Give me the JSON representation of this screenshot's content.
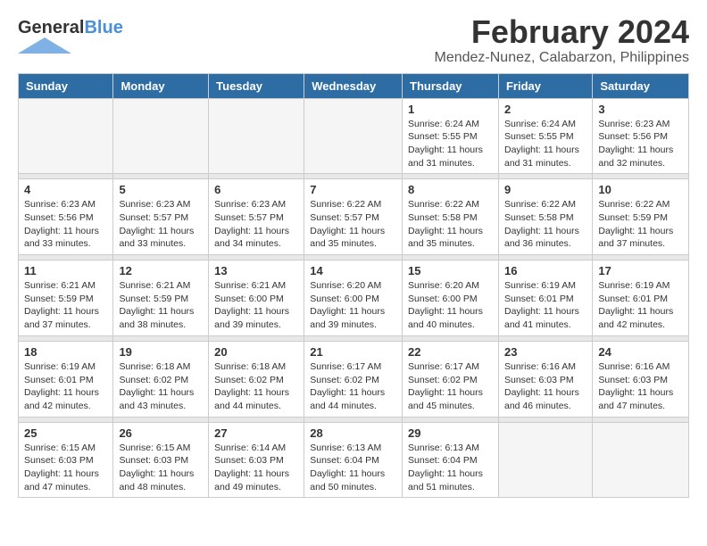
{
  "logo": {
    "general": "General",
    "blue": "Blue"
  },
  "title": "February 2024",
  "subtitle": "Mendez-Nunez, Calabarzon, Philippines",
  "days_of_week": [
    "Sunday",
    "Monday",
    "Tuesday",
    "Wednesday",
    "Thursday",
    "Friday",
    "Saturday"
  ],
  "weeks": [
    {
      "days": [
        {
          "num": "",
          "info": ""
        },
        {
          "num": "",
          "info": ""
        },
        {
          "num": "",
          "info": ""
        },
        {
          "num": "",
          "info": ""
        },
        {
          "num": "1",
          "info": "Sunrise: 6:24 AM\nSunset: 5:55 PM\nDaylight: 11 hours and 31 minutes."
        },
        {
          "num": "2",
          "info": "Sunrise: 6:24 AM\nSunset: 5:55 PM\nDaylight: 11 hours and 31 minutes."
        },
        {
          "num": "3",
          "info": "Sunrise: 6:23 AM\nSunset: 5:56 PM\nDaylight: 11 hours and 32 minutes."
        }
      ]
    },
    {
      "days": [
        {
          "num": "4",
          "info": "Sunrise: 6:23 AM\nSunset: 5:56 PM\nDaylight: 11 hours and 33 minutes."
        },
        {
          "num": "5",
          "info": "Sunrise: 6:23 AM\nSunset: 5:57 PM\nDaylight: 11 hours and 33 minutes."
        },
        {
          "num": "6",
          "info": "Sunrise: 6:23 AM\nSunset: 5:57 PM\nDaylight: 11 hours and 34 minutes."
        },
        {
          "num": "7",
          "info": "Sunrise: 6:22 AM\nSunset: 5:57 PM\nDaylight: 11 hours and 35 minutes."
        },
        {
          "num": "8",
          "info": "Sunrise: 6:22 AM\nSunset: 5:58 PM\nDaylight: 11 hours and 35 minutes."
        },
        {
          "num": "9",
          "info": "Sunrise: 6:22 AM\nSunset: 5:58 PM\nDaylight: 11 hours and 36 minutes."
        },
        {
          "num": "10",
          "info": "Sunrise: 6:22 AM\nSunset: 5:59 PM\nDaylight: 11 hours and 37 minutes."
        }
      ]
    },
    {
      "days": [
        {
          "num": "11",
          "info": "Sunrise: 6:21 AM\nSunset: 5:59 PM\nDaylight: 11 hours and 37 minutes."
        },
        {
          "num": "12",
          "info": "Sunrise: 6:21 AM\nSunset: 5:59 PM\nDaylight: 11 hours and 38 minutes."
        },
        {
          "num": "13",
          "info": "Sunrise: 6:21 AM\nSunset: 6:00 PM\nDaylight: 11 hours and 39 minutes."
        },
        {
          "num": "14",
          "info": "Sunrise: 6:20 AM\nSunset: 6:00 PM\nDaylight: 11 hours and 39 minutes."
        },
        {
          "num": "15",
          "info": "Sunrise: 6:20 AM\nSunset: 6:00 PM\nDaylight: 11 hours and 40 minutes."
        },
        {
          "num": "16",
          "info": "Sunrise: 6:19 AM\nSunset: 6:01 PM\nDaylight: 11 hours and 41 minutes."
        },
        {
          "num": "17",
          "info": "Sunrise: 6:19 AM\nSunset: 6:01 PM\nDaylight: 11 hours and 42 minutes."
        }
      ]
    },
    {
      "days": [
        {
          "num": "18",
          "info": "Sunrise: 6:19 AM\nSunset: 6:01 PM\nDaylight: 11 hours and 42 minutes."
        },
        {
          "num": "19",
          "info": "Sunrise: 6:18 AM\nSunset: 6:02 PM\nDaylight: 11 hours and 43 minutes."
        },
        {
          "num": "20",
          "info": "Sunrise: 6:18 AM\nSunset: 6:02 PM\nDaylight: 11 hours and 44 minutes."
        },
        {
          "num": "21",
          "info": "Sunrise: 6:17 AM\nSunset: 6:02 PM\nDaylight: 11 hours and 44 minutes."
        },
        {
          "num": "22",
          "info": "Sunrise: 6:17 AM\nSunset: 6:02 PM\nDaylight: 11 hours and 45 minutes."
        },
        {
          "num": "23",
          "info": "Sunrise: 6:16 AM\nSunset: 6:03 PM\nDaylight: 11 hours and 46 minutes."
        },
        {
          "num": "24",
          "info": "Sunrise: 6:16 AM\nSunset: 6:03 PM\nDaylight: 11 hours and 47 minutes."
        }
      ]
    },
    {
      "days": [
        {
          "num": "25",
          "info": "Sunrise: 6:15 AM\nSunset: 6:03 PM\nDaylight: 11 hours and 47 minutes."
        },
        {
          "num": "26",
          "info": "Sunrise: 6:15 AM\nSunset: 6:03 PM\nDaylight: 11 hours and 48 minutes."
        },
        {
          "num": "27",
          "info": "Sunrise: 6:14 AM\nSunset: 6:03 PM\nDaylight: 11 hours and 49 minutes."
        },
        {
          "num": "28",
          "info": "Sunrise: 6:13 AM\nSunset: 6:04 PM\nDaylight: 11 hours and 50 minutes."
        },
        {
          "num": "29",
          "info": "Sunrise: 6:13 AM\nSunset: 6:04 PM\nDaylight: 11 hours and 51 minutes."
        },
        {
          "num": "",
          "info": ""
        },
        {
          "num": "",
          "info": ""
        }
      ]
    }
  ]
}
